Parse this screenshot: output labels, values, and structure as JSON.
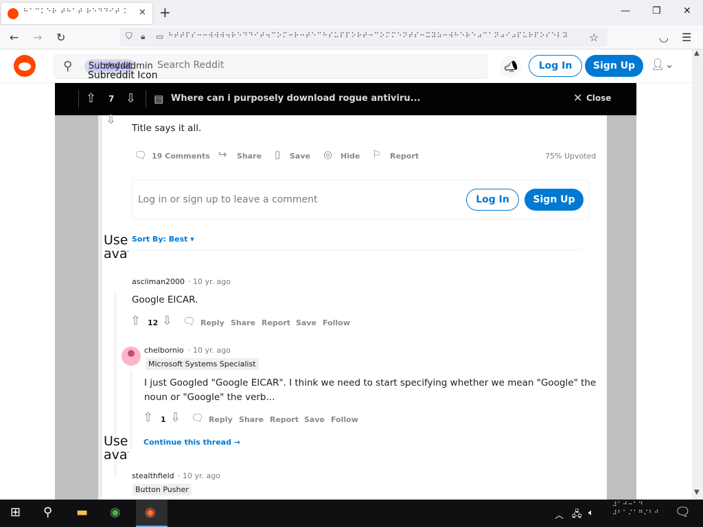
{
  "browser": {
    "tab_title": "⠓⠁⠉⠅⠑⠗ ⠞⠓⠁⠞ ⠗⠑⠙⠙⠊⠞ ⠕⠧",
    "tab_close": "✕",
    "new_tab": "+",
    "url": "⠓⠞⠞⠏⠎⠒⠒⠺⠺⠺⠲⠗⠑⠙⠙⠊⠞⠲⠉⠕⠍⠒⠗⠒⠞⠑⠉⠓⠎⠥⠏⠏⠕⠗⠞⠒⠉⠕⠍⠍⠑⠝⠞⠎⠒⠭⠽⠵⠒⠺⠓⠑⠗⠑⠴⠉⠁⠝⠴⠊⠴⠏⠥⠗⠏⠕⠎⠑⠇⠽",
    "window_controls": {
      "minimize": "—",
      "maximize": "❐",
      "close": "✕"
    }
  },
  "reddit_header": {
    "search_chip": "Subreddit",
    "search_chip_overlay": "r/sysadmin",
    "search_chip_icon_alt": "Subreddit Icon",
    "search_placeholder": "Search Reddit",
    "login_label": "Log In",
    "signup_label": "Sign Up"
  },
  "post_bar": {
    "score": "7",
    "title": "Where can i purposely download rogue antiviru...",
    "close_label": "Close"
  },
  "post": {
    "body": "Title says it all.",
    "actions": {
      "comments": "19 Comments",
      "share": "Share",
      "save": "Save",
      "hide": "Hide",
      "report": "Report"
    },
    "upvoted": "75% Upvoted"
  },
  "comment_prompt": {
    "text": "Log in or sign up to leave a comment",
    "login_label": "Log In",
    "signup_label": "Sign Up"
  },
  "sort": {
    "label": "Sort By: Best"
  },
  "avatar_alt": "User avatar",
  "comments": [
    {
      "user": "asciiman2000",
      "time": "· 10 yr. ago",
      "body": "Google EICAR.",
      "score": "12",
      "actions": [
        "Reply",
        "Share",
        "Report",
        "Save",
        "Follow"
      ]
    },
    {
      "user": "chelbornio",
      "time": "· 10 yr. ago",
      "flair": "Microsoft Systems Specialist",
      "body_line1": "I just Googled \"Google EICAR\". I think we need to start specifying whether we mean \"Google\" the",
      "body_line2": "noun or \"Google\" the verb...",
      "score": "1",
      "actions": [
        "Reply",
        "Share",
        "Report",
        "Save",
        "Follow"
      ],
      "continue": "Continue this thread"
    },
    {
      "user": "stealthfield",
      "time": "· 10 yr. ago",
      "flair": "Button Pusher"
    }
  ],
  "taskbar": {
    "clock_line1": "⠼⠁⠚⠒⠁⠙",
    "clock_line2": "⠼⠃⠁⠌⠁⠛⠌⠃⠚"
  },
  "colors": {
    "reddit_orange": "#ff4500",
    "reddit_blue": "#0079d3",
    "postbar_bg": "#030303"
  }
}
